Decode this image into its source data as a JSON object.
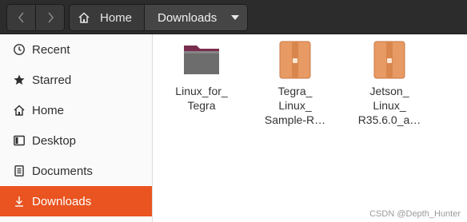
{
  "header": {
    "back_icon": "chevron-left-icon",
    "forward_icon": "chevron-right-icon",
    "breadcrumb": [
      {
        "label": "Home",
        "icon": "home-icon"
      },
      {
        "label": "Downloads"
      }
    ]
  },
  "sidebar": {
    "items": [
      {
        "label": "Recent",
        "icon": "clock-icon"
      },
      {
        "label": "Starred",
        "icon": "star-icon"
      },
      {
        "label": "Home",
        "icon": "home-icon"
      },
      {
        "label": "Desktop",
        "icon": "desktop-icon"
      },
      {
        "label": "Documents",
        "icon": "document-icon"
      },
      {
        "label": "Downloads",
        "icon": "download-icon",
        "selected": true
      }
    ]
  },
  "files": [
    {
      "name": "Linux_for_\nTegra",
      "type": "folder"
    },
    {
      "name": "Tegra_\nLinux_\nSample-R…",
      "type": "archive"
    },
    {
      "name": "Jetson_\nLinux_\nR35.6.0_a…",
      "type": "archive"
    }
  ],
  "watermark": "CSDN @Depth_Hunter",
  "colors": {
    "accent": "#e95420",
    "headerbar": "#2c2c2c",
    "archive": "#e79a63",
    "folder": "#6d6d6d"
  }
}
